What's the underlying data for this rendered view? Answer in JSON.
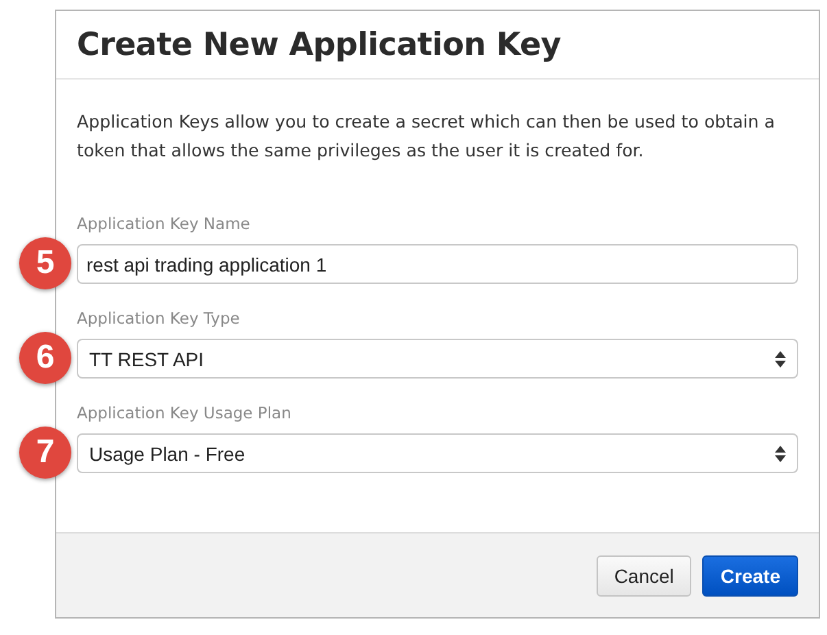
{
  "dialog": {
    "title": "Create New Application Key",
    "description": "Application Keys allow you to create a secret which can then be used to obtain a token that allows the same privileges as the user it is created for."
  },
  "fields": [
    {
      "label": "Application Key Name",
      "kind": "text",
      "value": "rest api trading application 1",
      "step": "5"
    },
    {
      "label": "Application Key Type",
      "kind": "select",
      "value": "TT REST API",
      "step": "6"
    },
    {
      "label": "Application Key Usage Plan",
      "kind": "select",
      "value": "Usage Plan - Free",
      "step": "7"
    }
  ],
  "buttons": [
    {
      "label": "Cancel",
      "kind": "secondary"
    },
    {
      "label": "Create",
      "kind": "primary"
    }
  ]
}
